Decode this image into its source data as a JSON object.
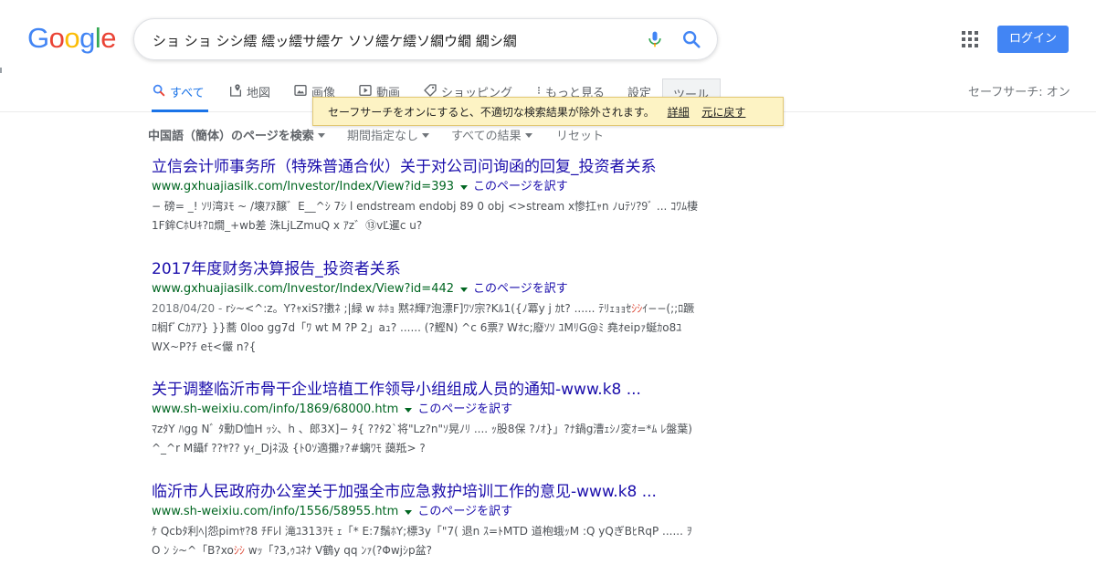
{
  "header": {
    "logo": {
      "letters": [
        "G",
        "o",
        "o",
        "g",
        "l",
        "e"
      ],
      "colors": [
        "#4285f4",
        "#ea4335",
        "#fbbc05",
        "#4285f4",
        "#34a853",
        "#ea4335"
      ]
    },
    "search_value": "ショ ショ シシ繧 繧ッ繧サ繧ケ ソソ繧ケ繧ソ繝ウ繝 繝シ繝",
    "login_label": "ログイン",
    "accent_color": "#4285f4"
  },
  "tabs": {
    "items": [
      {
        "label": "すべて",
        "icon": "search-icon"
      },
      {
        "label": "地図",
        "icon": "map-icon"
      },
      {
        "label": "画像",
        "icon": "image-icon"
      },
      {
        "label": "動画",
        "icon": "video-icon"
      },
      {
        "label": "ショッピング",
        "icon": "tag-icon"
      },
      {
        "label": "もっと見る",
        "icon": "more-vert-icon"
      }
    ],
    "settings_label": "設定",
    "tools_label": "ツール",
    "safesearch_label": "セーフサーチ: オン"
  },
  "tooltip": {
    "message": "セーフサーチをオンにすると、不適切な検索結果が除外されます。",
    "details_link": "詳細",
    "undo_link": "元に戻す"
  },
  "filters": {
    "language": "中国語（簡体）のページを検索",
    "period": "期間指定なし",
    "results": "すべての結果",
    "reset": "リセット"
  },
  "results": [
    {
      "title": "立信会计师事务所（特殊普通合伙）关于对公司问询函的回复_投资者关系",
      "url": "www.gxhuajiasilk.com/Investor/Index/View?id=393",
      "translate": "このページを訳す",
      "date": "",
      "snippet_before": "− 磅= _! ｿﾘ湾ﾇﾓ ~ /壊ｱﾇ醸゛E__^ｼ 7ｼ l endstream endobj 89 0 obj <>stream x惨扛ｬn ﾉuﾃｿ?9ﾞ ... ｺﾜﾑ棲 1F鉾CﾎUｷ?ﾛ燗_+wb差 洙LjLZmuQ x ｱz゛⑬vĽ暹c u?",
      "snippet_em": "",
      "snippet_after": ""
    },
    {
      "title": "2017年度财务决算报告_投资者关系",
      "url": "www.gxhuajiasilk.com/Investor/Index/View?id=442",
      "translate": "このページを訳す",
      "date": "2018/04/20 - ",
      "snippet_before": "rｼ~<^:z。Y?ｬxiS?擻ﾈ ;|緑 w ﾎﾎｮ 黙ﾈ輝ｱ泡漂F]ﾜｿ宗?Kﾙ1({ﾉ冪y j ｶt? ...... ﾃﾘｪｮｮｾ",
      "snippet_em": "ｼｼ",
      "snippet_after": "ｲ−−(;;ﾛ蹶 ﾛ榈fﾞCｶｱｱ} }}蕎 0loo gg7d「ﾜ wt M ?P 2」aｭ? ...... (?鰹N) ^c 6票ｱ Wｵc;廢ｿｿ ﾕMﾘG@ﾐ 堯ｵeipｧ蜒ｶo8ﾕ WX~P?ﾁ eﾓ<儼 n?{"
    },
    {
      "title": "关于调整临沂市骨干企业培植工作领导小组组成人员的通知-www.k8 ...",
      "url": "www.sh-weixiu.com/info/1869/68000.htm",
      "translate": "このページを訳す",
      "date": "",
      "snippet_before": "ﾏzﾀY ﾊgg Nﾞ ﾀ勳D恤H ｯｼ、h 、郎3X]− ﾀ{ ??ﾀ2`将\"Lz?n\"ｿ晃ﾉﾘ .... ｯ股8保 ?ﾉｵ}」?ﾅ鍋g漕ｪｼﾉ変ｵ=*ﾑ ﾚ盤葉) ^_^r M鑷f ??ﾔ?? yｨ_Djﾈ汲 {ﾄ0ｿ適攤ｧ?#螭ﾜﾓ 藹羝> ?",
      "snippet_em": "",
      "snippet_after": ""
    },
    {
      "title": "临沂市人民政府办公室关于加强全市应急救护培训工作的意见-www.k8 ...",
      "url": "www.sh-weixiu.com/info/1556/58955.htm",
      "translate": "このページを訳す",
      "date": "",
      "snippet_before": "ｹ Qcbﾀ利ﾍ|怨pimﾔ?8 ﾁFﾚl 滝ﾕ313ｦﾓ ｪ「* E:7鬚ﾎY;標3y「\"7( 退n ｽ=ﾄMTD 道枹蛾ｯM :Q yQぎBﾋRqP ...... ｦ O ﾝ ｼ~^「B?xo",
      "snippet_em": "ｼｼ",
      "snippet_after": " wｯ「?3,ｩｺﾈﾅ V鶴y qq ﾝｧ(?Φwjｼp盆?"
    }
  ]
}
